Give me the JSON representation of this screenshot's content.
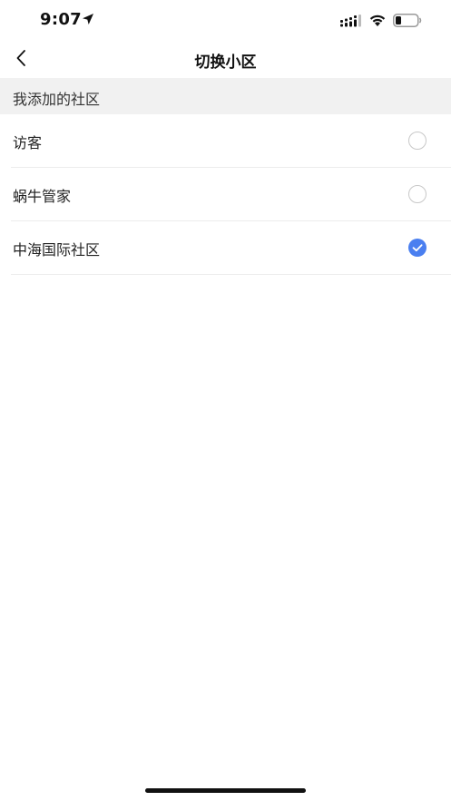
{
  "status_bar": {
    "time": "9:07",
    "icons": [
      "location-arrow-icon",
      "cellular-signal-icon",
      "wifi-icon",
      "battery-icon"
    ]
  },
  "nav": {
    "title": "切换小区",
    "back_icon": "chevron-left-icon"
  },
  "section": {
    "header": "我添加的社区"
  },
  "communities": [
    {
      "label": "访客",
      "selected": false
    },
    {
      "label": "蜗牛管家",
      "selected": false
    },
    {
      "label": "中海国际社区",
      "selected": true
    }
  ],
  "colors": {
    "accent": "#4a7ff0",
    "section_bg": "#f1f1f1",
    "divider": "#ececec"
  }
}
